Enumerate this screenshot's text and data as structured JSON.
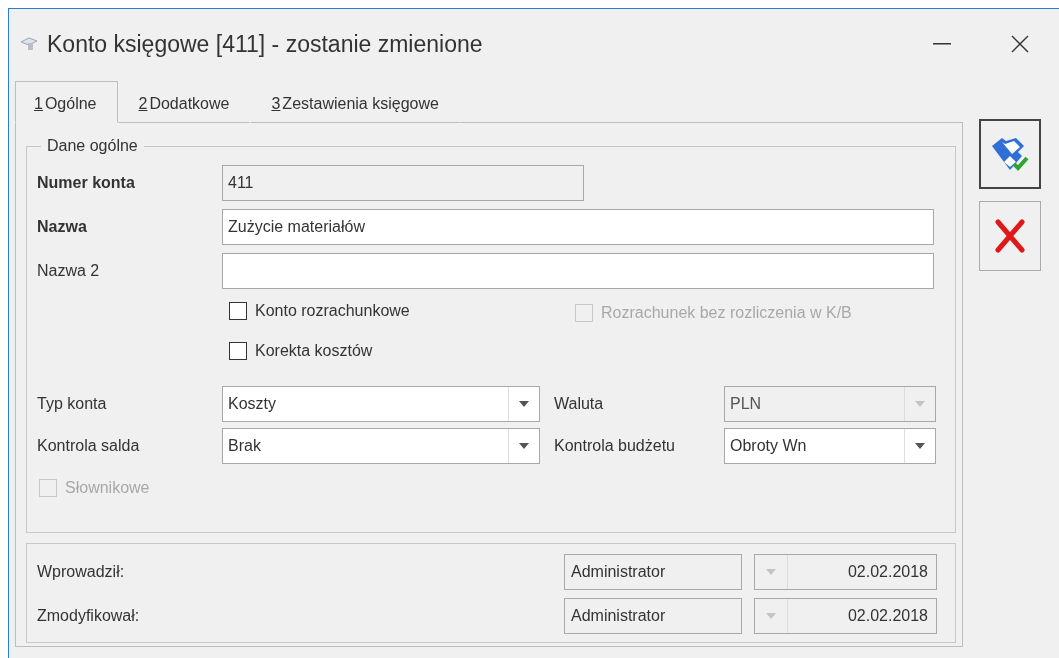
{
  "window": {
    "title": "Konto księgowe [411] - zostanie zmienione"
  },
  "tabs": [
    {
      "key": "1",
      "label": "Ogólne",
      "selected": true
    },
    {
      "key": "2",
      "label": "Dodatkowe",
      "selected": false
    },
    {
      "key": "3",
      "label": "Zestawienia księgowe",
      "selected": false
    }
  ],
  "group": {
    "title": "Dane ogólne"
  },
  "text_fields": [
    {
      "label": "Numer konta",
      "value": "411",
      "bold": true,
      "disabled": true,
      "kind": "short"
    },
    {
      "label": "Nazwa",
      "value": "Zużycie materiałów",
      "bold": true,
      "disabled": false,
      "kind": "long"
    },
    {
      "label": "Nazwa 2",
      "bold": false,
      "disabled": false,
      "kind": "long"
    }
  ],
  "checkboxes": [
    {
      "label": "Konto rozrachunkowe",
      "checked": false,
      "disabled": false
    },
    {
      "label": "Rozrachunek bez rozliczenia w K/B",
      "checked": false,
      "disabled": true
    },
    {
      "label": "Korekta kosztów",
      "checked": false,
      "disabled": false
    }
  ],
  "dropdowns": [
    {
      "label": "Typ konta",
      "value": "Koszty",
      "disabled": false
    },
    {
      "label": "Waluta",
      "value": "PLN",
      "disabled": true
    },
    {
      "label": "Kontrola salda",
      "value": "Brak",
      "disabled": false
    },
    {
      "label": "Kontrola budżetu",
      "value": "Obroty Wn",
      "disabled": false
    }
  ],
  "dictionary_checkbox": {
    "label": "Słownikowe",
    "checked": false,
    "disabled": true
  },
  "audit": [
    {
      "label": "Wprowadził:",
      "user": "Administrator",
      "date": "02.02.2018"
    },
    {
      "label": "Zmodyfikował:",
      "user": "Administrator",
      "date": "02.02.2018"
    }
  ],
  "buttons": [
    {
      "kind": "save",
      "focused": true
    },
    {
      "kind": "cancel",
      "focused": false
    }
  ]
}
